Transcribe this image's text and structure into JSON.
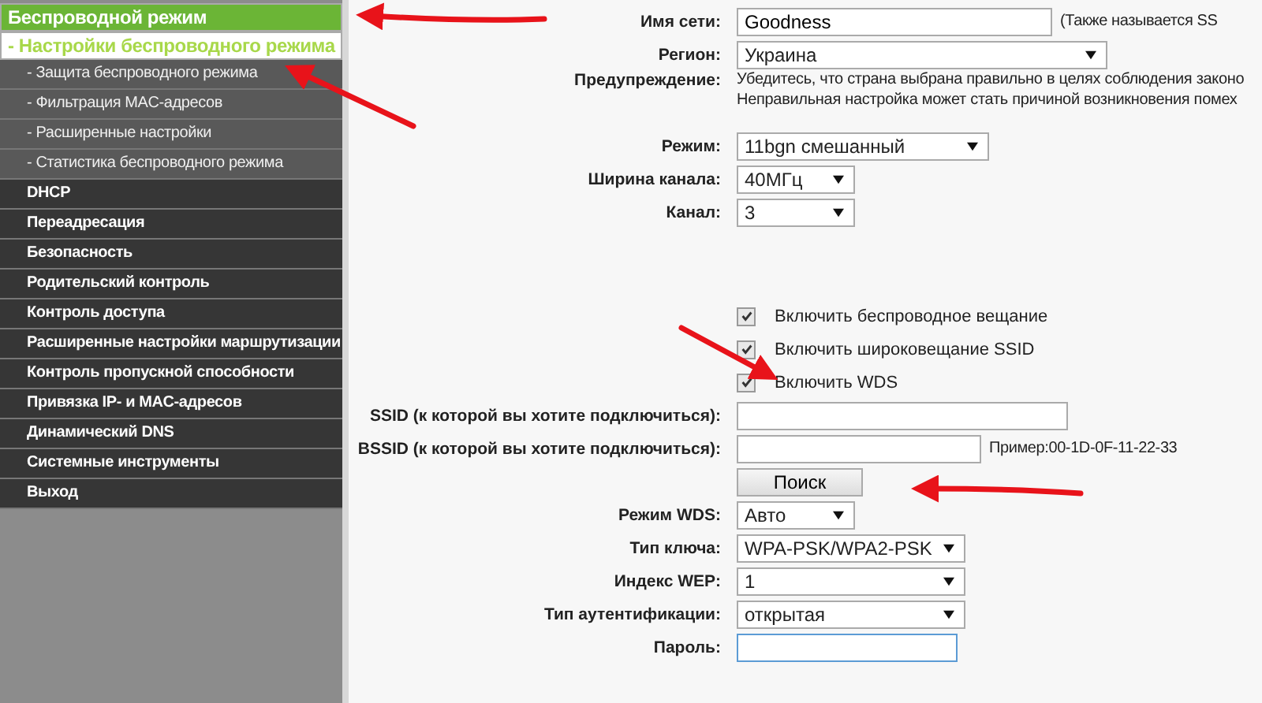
{
  "menu": [
    {
      "label": "Беспроводной режим",
      "selected": true,
      "children": [
        {
          "label": "- Настройки беспроводного режима",
          "selected": true
        },
        {
          "label": "- Защита беспроводного режима",
          "selected": false
        },
        {
          "label": "- Фильтрация MAC-адресов",
          "selected": false
        },
        {
          "label": "- Расширенные настройки",
          "selected": false
        },
        {
          "label": "- Статистика беспроводного режима",
          "selected": false
        }
      ]
    },
    {
      "label": "DHCP",
      "selected": false
    },
    {
      "label": "Переадресация",
      "selected": false
    },
    {
      "label": "Безопасность",
      "selected": false
    },
    {
      "label": "Родительский контроль",
      "selected": false
    },
    {
      "label": "Контроль доступа",
      "selected": false
    },
    {
      "label": "Расширенные настройки маршрутизации",
      "selected": false
    },
    {
      "label": "Контроль пропускной способности",
      "selected": false
    },
    {
      "label": "Привязка IP- и MAC-адресов",
      "selected": false
    },
    {
      "label": "Динамический DNS",
      "selected": false
    },
    {
      "label": "Системные инструменты",
      "selected": false
    },
    {
      "label": "Выход",
      "selected": false
    }
  ],
  "sections": [
    [
      {
        "kind": "text",
        "label": "Имя сети:",
        "value": "Goodness",
        "note": "(Также называется SS"
      },
      {
        "kind": "select",
        "label": "Регион:",
        "value": "Украина"
      },
      {
        "kind": "warning",
        "label": "Предупреждение:",
        "lines": [
          "Убедитесь, что страна выбрана правильно в целях соблюдения законо",
          "Неправильная настройка может стать причиной возникновения помех"
        ]
      }
    ],
    [
      {
        "kind": "select",
        "label": "Режим:",
        "value": "11bgn смешанный"
      },
      {
        "kind": "select",
        "label": "Ширина канала:",
        "value": "40МГц"
      },
      {
        "kind": "select",
        "label": "Канал:",
        "value": "3"
      }
    ],
    [
      {
        "kind": "checkbox",
        "label": "Включить беспроводное вещание",
        "checked": true
      },
      {
        "kind": "checkbox",
        "label": "Включить широковещание SSID",
        "checked": true
      },
      {
        "kind": "checkbox",
        "label": "Включить WDS",
        "checked": true
      },
      {
        "kind": "text",
        "label": "SSID (к которой вы хотите подключиться):"
      },
      {
        "kind": "text",
        "label": "BSSID (к которой вы хотите подключиться):",
        "note": "Пример:00-1D-0F-11-22-33"
      },
      {
        "kind": "button",
        "label": "Поиск"
      },
      {
        "kind": "select",
        "label": "Режим WDS:",
        "value": "Авто"
      },
      {
        "kind": "select",
        "label": "Тип ключа:",
        "value": "WPA-PSK/WPA2-PSK"
      },
      {
        "kind": "select",
        "label": "Индекс WEP:",
        "value": "1"
      },
      {
        "kind": "select",
        "label": "Тип аутентификации:",
        "value": "открытая"
      },
      {
        "kind": "password",
        "label": "Пароль:",
        "focused": true
      }
    ]
  ]
}
